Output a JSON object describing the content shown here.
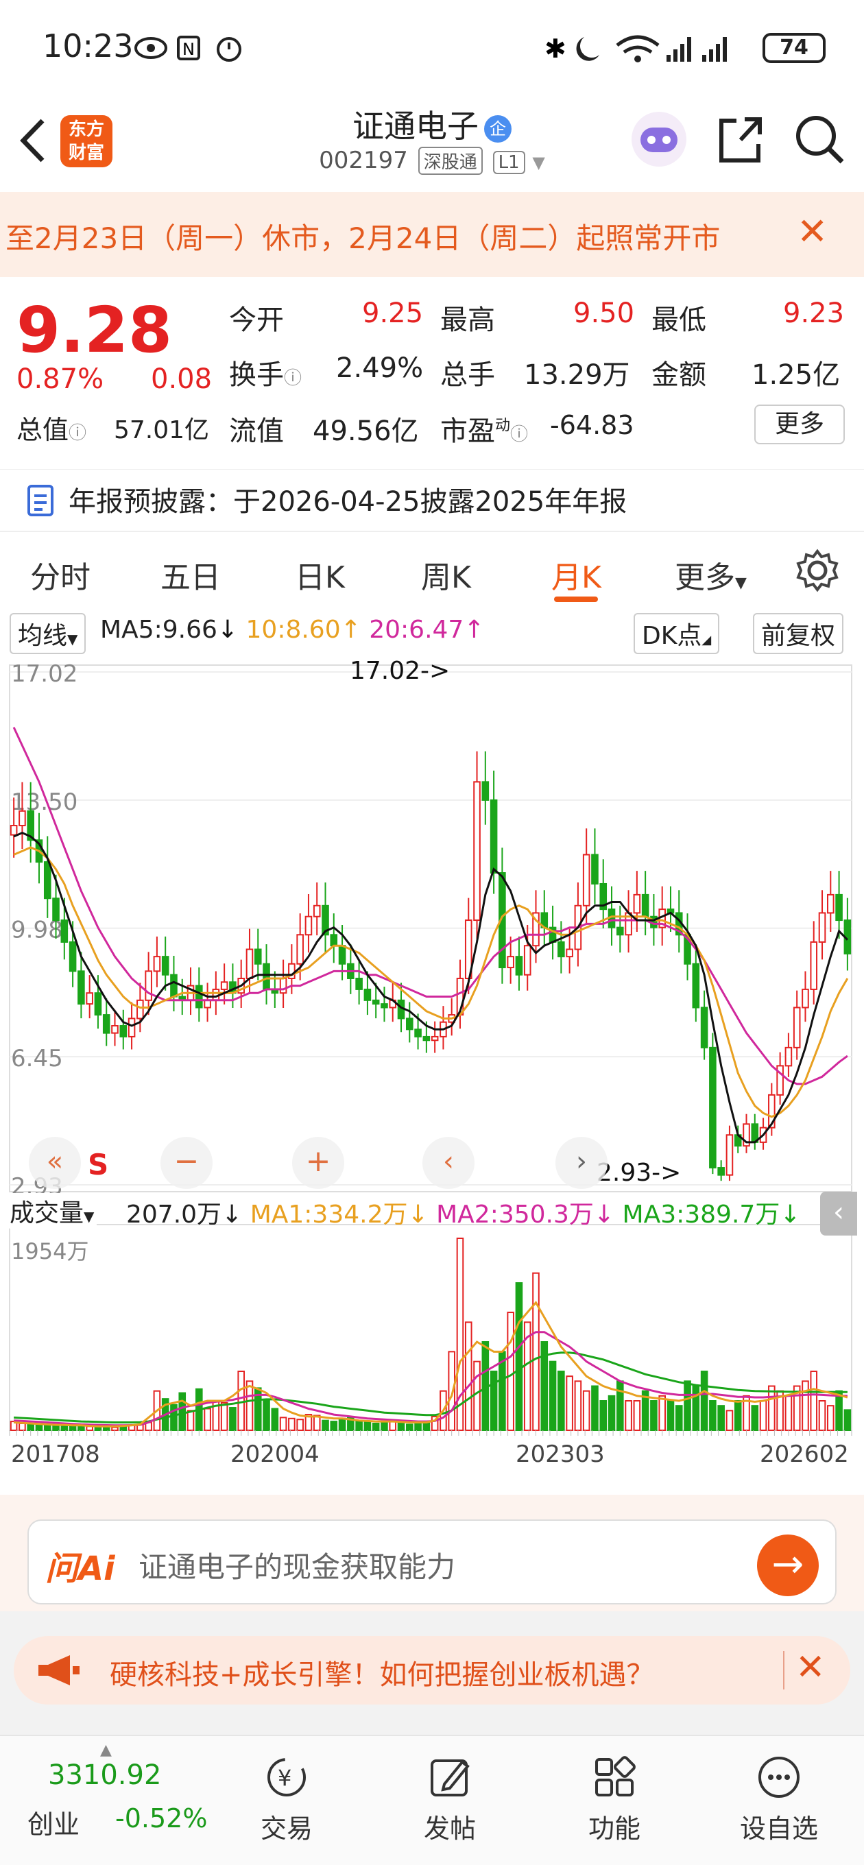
{
  "status": {
    "time": "10:23",
    "battery": "74"
  },
  "header": {
    "brand": "东方财富",
    "title": "证通电子",
    "title_badge": "企",
    "code": "002197",
    "exchange_tag": "深股通",
    "level_tag": "L1"
  },
  "notice": {
    "text": "至2月23日（周一）休市，2月24日（周二）起照常开市"
  },
  "quote": {
    "price": "9.28",
    "change_pct": "0.87%",
    "change": "0.08",
    "open_label": "今开",
    "open": "9.25",
    "high_label": "最高",
    "high": "9.50",
    "low_label": "最低",
    "low": "9.23",
    "turnover_label": "换手",
    "turnover": "2.49%",
    "volume_label": "总手",
    "volume": "13.29万",
    "amount_label": "金额",
    "amount": "1.25亿",
    "mktcap_label": "总值",
    "mktcap": "57.01亿",
    "float_label": "流值",
    "float": "49.56亿",
    "pe_label": "市盈",
    "pe_sup": "动",
    "pe": "-64.83",
    "more": "更多"
  },
  "report": {
    "text": "年报预披露：于2026-04-25披露2025年年报"
  },
  "tabs": [
    {
      "label": "分时"
    },
    {
      "label": "五日"
    },
    {
      "label": "日K"
    },
    {
      "label": "周K"
    },
    {
      "label": "月K"
    },
    {
      "label": "更多"
    }
  ],
  "chart_controls": {
    "indicator": "均线",
    "ma5": "MA5:9.66",
    "ma10": "10:8.60",
    "ma20": "20:6.47",
    "dk": "DK点",
    "adjust": "前复权",
    "s_label": "S",
    "volume_label": "成交量",
    "vol_value": "207.0万",
    "vma1": "MA1:334.2万",
    "vma2": "MA2:350.3万",
    "vma3": "MA3:389.7万"
  },
  "colors": {
    "up": "#e42222",
    "down": "#1aa51a",
    "ma5": "#111111",
    "ma10": "#e8a020",
    "ma20": "#d0289c",
    "accent": "#f05a16"
  },
  "chart_data": {
    "type": "candlestick",
    "price_axis": {
      "ticks": [
        "17.02",
        "13.50",
        "9.98",
        "6.45",
        "2.93"
      ],
      "ylim": [
        2.93,
        17.02
      ]
    },
    "annotations": [
      {
        "text": "17.02->",
        "value": 17.02
      },
      {
        "text": "2.93->",
        "value": 2.93
      }
    ],
    "volume_axis": {
      "max_label": "1954万",
      "max": 1954
    },
    "x_ticks": [
      "201708",
      "202004",
      "202303",
      "202602"
    ],
    "price_close": [
      12.8,
      13.2,
      12.4,
      11.8,
      10.8,
      10.2,
      9.6,
      8.8,
      7.9,
      8.2,
      7.6,
      7.1,
      7.3,
      7.0,
      7.5,
      8.0,
      8.8,
      9.2,
      8.7,
      8.1,
      8.0,
      8.4,
      7.8,
      8.0,
      8.3,
      8.5,
      8.2,
      8.6,
      9.4,
      9.0,
      8.3,
      8.2,
      8.6,
      9.0,
      9.8,
      10.3,
      10.6,
      9.8,
      9.5,
      9.0,
      8.6,
      8.3,
      8.0,
      7.9,
      7.8,
      8.0,
      7.5,
      7.2,
      7.0,
      6.9,
      7.0,
      7.4,
      7.6,
      8.6,
      10.2,
      14.0,
      13.5,
      11.5,
      8.9,
      9.2,
      8.7,
      9.5,
      10.4,
      10.0,
      9.6,
      9.2,
      9.4,
      10.6,
      12.0,
      11.2,
      10.5,
      10.0,
      9.8,
      10.4,
      10.9,
      10.3,
      10.0,
      10.5,
      10.4,
      9.8,
      9.0,
      7.8,
      6.7,
      3.4,
      3.2,
      4.3,
      4.0,
      4.6,
      4.1,
      4.5,
      5.4,
      6.2,
      6.7,
      7.8,
      8.3,
      9.6,
      10.4,
      10.9,
      10.2,
      9.28
    ],
    "ma5": [
      12.5,
      12.6,
      12.5,
      12.3,
      11.9,
      11.3,
      10.6,
      9.9,
      9.2,
      8.8,
      8.4,
      8.0,
      7.7,
      7.4,
      7.3,
      7.4,
      7.7,
      8.1,
      8.4,
      8.5,
      8.4,
      8.3,
      8.2,
      8.1,
      8.1,
      8.2,
      8.3,
      8.4,
      8.6,
      8.7,
      8.7,
      8.7,
      8.7,
      8.7,
      8.9,
      9.2,
      9.6,
      9.9,
      10.0,
      9.8,
      9.5,
      9.1,
      8.7,
      8.4,
      8.1,
      8.0,
      7.8,
      7.7,
      7.5,
      7.3,
      7.2,
      7.2,
      7.3,
      7.7,
      8.5,
      9.6,
      10.9,
      11.6,
      11.4,
      11.0,
      10.3,
      9.6,
      9.3,
      9.5,
      9.6,
      9.7,
      9.8,
      10.0,
      10.4,
      10.6,
      10.6,
      10.7,
      10.7,
      10.4,
      10.2,
      10.2,
      10.2,
      10.3,
      10.4,
      10.2,
      9.9,
      9.5,
      8.7,
      7.4,
      6.2,
      5.2,
      4.3,
      4.1,
      4.1,
      4.3,
      4.6,
      5.0,
      5.4,
      6.0,
      6.7,
      7.6,
      8.4,
      9.2,
      9.9,
      9.66
    ],
    "ma10": [
      12.0,
      12.1,
      12.2,
      12.1,
      11.9,
      11.6,
      11.2,
      10.6,
      10.1,
      9.6,
      9.1,
      8.7,
      8.4,
      8.1,
      7.9,
      7.8,
      7.8,
      7.9,
      8.0,
      8.1,
      8.2,
      8.2,
      8.2,
      8.2,
      8.2,
      8.2,
      8.2,
      8.3,
      8.4,
      8.5,
      8.6,
      8.6,
      8.6,
      8.7,
      8.8,
      8.9,
      9.1,
      9.3,
      9.5,
      9.5,
      9.4,
      9.3,
      9.1,
      8.9,
      8.7,
      8.5,
      8.3,
      8.1,
      7.9,
      7.7,
      7.6,
      7.5,
      7.5,
      7.6,
      7.9,
      8.4,
      9.1,
      9.8,
      10.3,
      10.5,
      10.6,
      10.5,
      10.2,
      10.0,
      9.9,
      9.8,
      9.8,
      9.9,
      10.0,
      10.1,
      10.2,
      10.3,
      10.3,
      10.3,
      10.3,
      10.3,
      10.2,
      10.2,
      10.1,
      10.0,
      9.8,
      9.5,
      9.1,
      8.4,
      7.6,
      6.8,
      6.0,
      5.5,
      5.1,
      4.9,
      4.8,
      4.9,
      5.1,
      5.4,
      5.8,
      6.4,
      7.0,
      7.7,
      8.2,
      8.6
    ],
    "ma20": [
      15.5,
      15.0,
      14.5,
      14.0,
      13.4,
      12.8,
      12.2,
      11.6,
      11.0,
      10.5,
      10.0,
      9.6,
      9.2,
      8.9,
      8.6,
      8.4,
      8.2,
      8.1,
      8.0,
      8.0,
      8.0,
      8.0,
      8.0,
      8.0,
      8.0,
      8.0,
      8.0,
      8.1,
      8.2,
      8.2,
      8.3,
      8.3,
      8.3,
      8.4,
      8.4,
      8.5,
      8.6,
      8.7,
      8.8,
      8.8,
      8.8,
      8.8,
      8.7,
      8.7,
      8.6,
      8.5,
      8.4,
      8.3,
      8.2,
      8.1,
      8.1,
      8.1,
      8.1,
      8.2,
      8.3,
      8.6,
      8.9,
      9.2,
      9.4,
      9.6,
      9.7,
      9.8,
      9.8,
      9.8,
      9.9,
      9.9,
      10.0,
      10.0,
      10.1,
      10.1,
      10.1,
      10.2,
      10.2,
      10.2,
      10.2,
      10.2,
      10.1,
      10.1,
      10.0,
      9.9,
      9.7,
      9.4,
      9.1,
      8.7,
      8.3,
      7.9,
      7.5,
      7.1,
      6.8,
      6.5,
      6.2,
      6.0,
      5.8,
      5.7,
      5.7,
      5.8,
      5.9,
      6.1,
      6.3,
      6.47
    ],
    "volume": [
      90,
      70,
      60,
      55,
      60,
      50,
      45,
      50,
      55,
      40,
      35,
      30,
      30,
      40,
      50,
      60,
      80,
      400,
      320,
      260,
      380,
      200,
      420,
      220,
      300,
      280,
      230,
      600,
      500,
      430,
      300,
      220,
      130,
      120,
      110,
      160,
      150,
      100,
      90,
      120,
      130,
      90,
      80,
      70,
      80,
      100,
      80,
      60,
      70,
      80,
      140,
      400,
      800,
      1954,
      1100,
      700,
      900,
      600,
      800,
      1200,
      1500,
      1100,
      1600,
      900,
      700,
      600,
      550,
      500,
      400,
      450,
      300,
      350,
      500,
      300,
      300,
      400,
      300,
      350,
      300,
      250,
      500,
      450,
      600,
      300,
      250,
      200,
      300,
      350,
      250,
      300,
      450,
      400,
      350,
      450,
      500,
      600,
      300,
      250,
      400,
      207
    ],
    "vma1": [
      80,
      75,
      70,
      65,
      60,
      55,
      55,
      50,
      50,
      45,
      40,
      40,
      40,
      45,
      50,
      60,
      130,
      200,
      260,
      280,
      300,
      250,
      280,
      300,
      300,
      300,
      350,
      420,
      450,
      420,
      380,
      300,
      220,
      180,
      150,
      140,
      140,
      130,
      120,
      120,
      110,
      100,
      95,
      90,
      90,
      90,
      85,
      80,
      80,
      80,
      100,
      200,
      350,
      700,
      800,
      900,
      850,
      800,
      800,
      900,
      1100,
      1200,
      1300,
      1150,
      1000,
      850,
      750,
      650,
      550,
      500,
      450,
      420,
      400,
      380,
      350,
      340,
      330,
      320,
      310,
      300,
      320,
      350,
      400,
      350,
      320,
      300,
      290,
      300,
      290,
      300,
      320,
      340,
      360,
      380,
      400,
      420,
      400,
      380,
      360,
      334.2
    ],
    "vma2": [
      100,
      95,
      90,
      85,
      80,
      75,
      70,
      65,
      60,
      58,
      55,
      52,
      50,
      50,
      52,
      55,
      80,
      120,
      160,
      200,
      230,
      250,
      260,
      280,
      290,
      300,
      310,
      330,
      350,
      360,
      360,
      340,
      310,
      280,
      250,
      220,
      200,
      180,
      160,
      150,
      140,
      130,
      120,
      115,
      110,
      105,
      100,
      95,
      90,
      90,
      95,
      130,
      200,
      350,
      450,
      550,
      600,
      650,
      700,
      750,
      850,
      950,
      1000,
      1000,
      950,
      900,
      850,
      780,
      700,
      650,
      600,
      550,
      500,
      470,
      440,
      420,
      400,
      380,
      370,
      360,
      360,
      360,
      370,
      370,
      360,
      350,
      340,
      340,
      335,
      335,
      340,
      345,
      350,
      355,
      360,
      365,
      360,
      355,
      352,
      350.3
    ],
    "vma3": [
      130,
      125,
      120,
      115,
      110,
      105,
      100,
      95,
      90,
      88,
      85,
      82,
      80,
      80,
      80,
      82,
      90,
      110,
      130,
      150,
      170,
      190,
      210,
      230,
      250,
      260,
      270,
      285,
      300,
      310,
      315,
      315,
      310,
      300,
      290,
      280,
      270,
      255,
      240,
      230,
      220,
      210,
      200,
      190,
      180,
      175,
      170,
      165,
      160,
      155,
      155,
      170,
      200,
      260,
      320,
      380,
      430,
      480,
      520,
      560,
      620,
      680,
      730,
      760,
      780,
      790,
      790,
      780,
      760,
      740,
      720,
      690,
      660,
      630,
      600,
      570,
      550,
      530,
      510,
      490,
      475,
      460,
      450,
      440,
      430,
      420,
      410,
      405,
      400,
      398,
      396,
      394,
      393,
      392,
      391,
      391,
      390,
      390,
      390,
      389.7
    ]
  },
  "askai": {
    "label": "问Ai",
    "question": "证通电子的现金获取能力"
  },
  "promo": {
    "text": "硬核科技+成长引擎！如何把握创业板机遇？"
  },
  "bottomnav": {
    "index_value": "3310.92",
    "index_name": "创业",
    "index_change": "-0.52%",
    "items": [
      {
        "label": "交易"
      },
      {
        "label": "发帖"
      },
      {
        "label": "功能"
      },
      {
        "label": "设自选"
      }
    ]
  }
}
